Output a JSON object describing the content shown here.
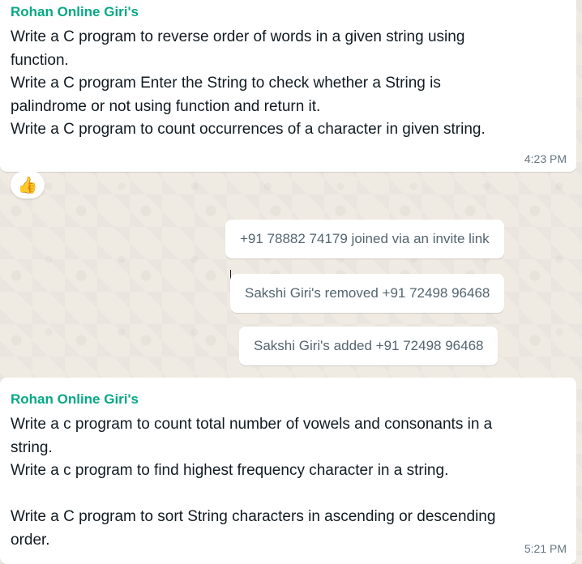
{
  "messages": {
    "first": {
      "sender": "Rohan Online Giri's",
      "lines": [
        "Write a C program to reverse order of words in a given string using",
        "function.",
        "Write a C program Enter the String to check whether a String is",
        "palindrome or not using function and return it.",
        "Write a C program to count occurrences of a character in given string."
      ],
      "time": "4:23 PM",
      "reaction": "👍"
    },
    "second": {
      "sender": "Rohan Online Giri's",
      "lines": [
        "Write a c program to count total number of vowels and consonants in a",
        "string.",
        "Write a c program to find highest frequency character in a string.",
        "",
        "Write a C program to sort String characters in ascending or descending",
        "order."
      ],
      "time": "5:21 PM"
    }
  },
  "system_messages": [
    "+91 78882 74179 joined via an invite link",
    "Sakshi Giri's removed +91 72498 96468",
    "Sakshi Giri's added +91 72498 96468"
  ]
}
